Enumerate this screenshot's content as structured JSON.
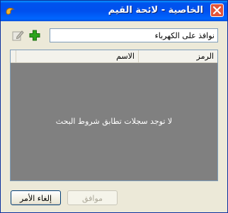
{
  "window": {
    "title": "الخاصية - لائحة القيم"
  },
  "icons": {
    "app": "app-icon",
    "add": "plus-icon",
    "edit": "edit-icon",
    "close": "close-icon"
  },
  "search": {
    "value": "نوافذ على الكهرباء",
    "placeholder": ""
  },
  "grid": {
    "columns": [
      "الرمز",
      "الاسم"
    ],
    "empty_message": "لا توجد سجلات تطابق شروط البحث"
  },
  "buttons": {
    "ok_label": "موافق",
    "cancel_label": "إلغاء الأمر"
  },
  "colors": {
    "title_bar": "#0054e3",
    "grid_background": "#808080",
    "add_icon": "#2da41d",
    "close_button": "#e2553a"
  }
}
